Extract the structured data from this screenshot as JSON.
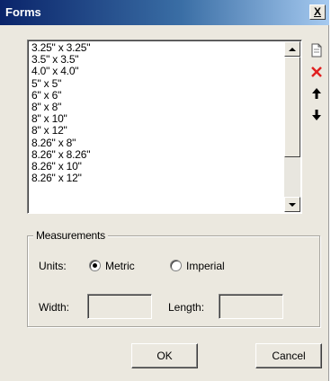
{
  "window": {
    "title": "Forms",
    "close_label": "X"
  },
  "forms_list": {
    "items": [
      "3.25\" x 3.25\"",
      "3.5\" x 3.5\"",
      "4.0\" x 4.0\"",
      "5\" x 5\"",
      "6\" x 6\"",
      "8\" x 8\"",
      "8\" x 10\"",
      "8\" x 12\"",
      "8.26\" x 8\"",
      "8.26\" x 8.26\"",
      "8.26\" x 10\"",
      "8.26\" x 12\""
    ]
  },
  "side_tools": {
    "icons": [
      "new-form-icon",
      "delete-icon",
      "move-up-icon",
      "move-down-icon"
    ],
    "delete_color": "#e02020"
  },
  "measurements": {
    "group_label": "Measurements",
    "units_label": "Units:",
    "metric_label": "Metric",
    "imperial_label": "Imperial",
    "selected_unit": "Metric",
    "width_label": "Width:",
    "length_label": "Length:",
    "width_value": "",
    "length_value": ""
  },
  "buttons": {
    "ok_label": "OK",
    "cancel_label": "Cancel"
  }
}
